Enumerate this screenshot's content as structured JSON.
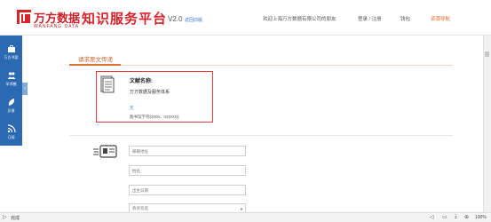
{
  "header": {
    "logo_cn": "万方数据",
    "logo_en": "WANFANG DATA",
    "site_title": "知识服务平台",
    "version": "V2.0",
    "old_version_link": "返回旧版",
    "welcome": "欢迎上海万方数据有限公司的朋友",
    "login_register": "登录 / 注册",
    "shopcart": "钱包",
    "resource_nav": "资源导航"
  },
  "sidebar": {
    "items": [
      {
        "label": "万方书案",
        "icon": "briefcase-icon"
      },
      {
        "label": "学术圈",
        "icon": "people-icon"
      },
      {
        "label": "反馈",
        "icon": "leaf-icon"
      },
      {
        "label": "订阅",
        "icon": "rss-icon"
      }
    ],
    "toggle": "‹"
  },
  "main": {
    "tab_title": "请求原文传递",
    "doc": {
      "name_label": "文献名称:",
      "name": "万方数据及服务体系",
      "author": "无",
      "source": "图书馆学刊(2006，02(003))"
    },
    "form": {
      "email_placeholder": "邮箱地址",
      "name_placeholder": "姓名",
      "birthday_placeholder": "出生日期",
      "education_value": "教育程度"
    }
  },
  "statusbar": {
    "status": "完成",
    "zoom": "100%"
  },
  "colors": {
    "brand_red": "#d8232a",
    "accent_orange": "#e07230",
    "sidebar_blue": "#2b6ab2",
    "highlight_border": "#e53d3d"
  }
}
